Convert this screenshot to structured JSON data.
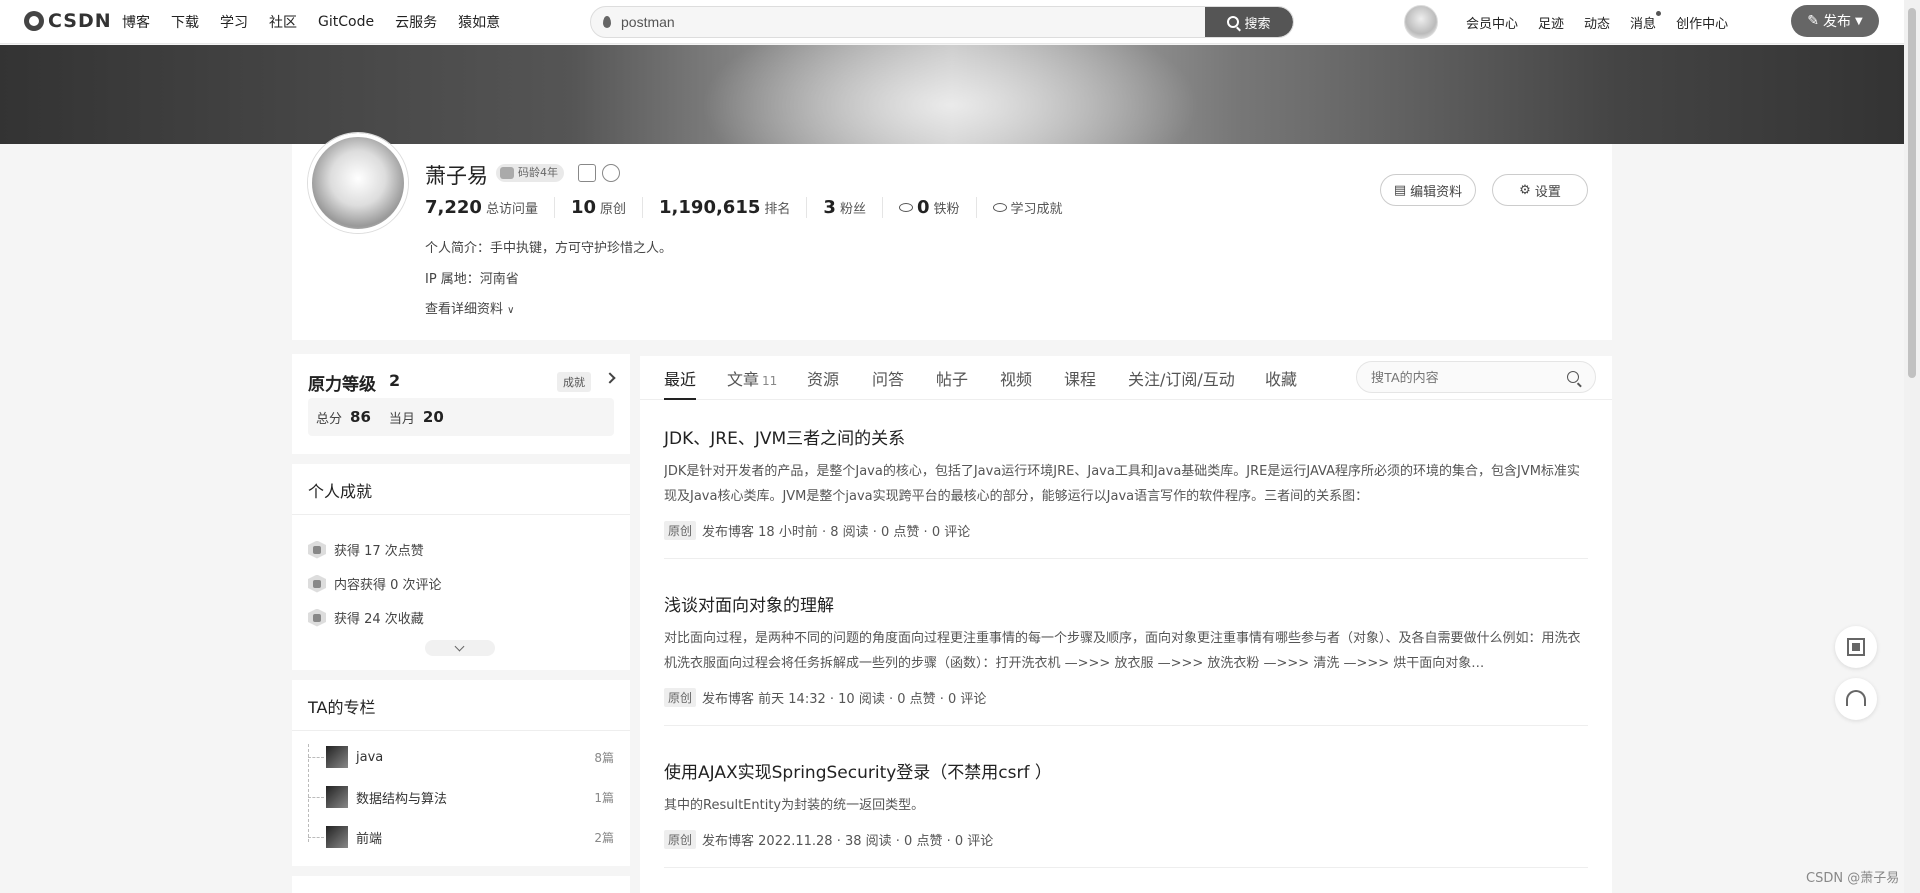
{
  "nav": {
    "logo": "CSDN",
    "links": [
      "博客",
      "下载",
      "学习",
      "社区",
      "GitCode",
      "云服务",
      "猿如意"
    ],
    "search_value": "postman",
    "search_button": "搜索",
    "right_links": [
      "会员中心",
      "足迹",
      "动态",
      "消息",
      "创作中心"
    ],
    "publish": "发布"
  },
  "profile": {
    "name": "萧子易",
    "age_badge": "码龄4年",
    "stats": [
      {
        "value": "7,220",
        "label": "总访问量"
      },
      {
        "value": "10",
        "label": "原创"
      },
      {
        "value": "1,190,615",
        "label": "排名"
      },
      {
        "value": "3",
        "label": "粉丝"
      },
      {
        "value": "0",
        "label": "铁粉"
      },
      {
        "value": "",
        "label": "学习成就"
      }
    ],
    "intro": "个人简介：手中执键，方可守护珍惜之人。",
    "ip": "IP 属地：河南省",
    "more": "查看详细资料",
    "edit_button": "编辑资料",
    "settings_button": "设置"
  },
  "level": {
    "title": "原力等级",
    "level": "2",
    "tag": "成就",
    "total_label": "总分",
    "total": "86",
    "month_label": "当月",
    "month": "20"
  },
  "achievements": {
    "title": "个人成就",
    "items": [
      "获得 17 次点赞",
      "内容获得 0 次评论",
      "获得 24 次收藏"
    ]
  },
  "columns": {
    "title": "TA的专栏",
    "items": [
      {
        "name": "java",
        "count": "8篇"
      },
      {
        "name": "数据结构与算法",
        "count": "1篇"
      },
      {
        "name": "前端",
        "count": "2篇"
      }
    ]
  },
  "tabs": {
    "items": [
      "最近",
      "文章",
      "资源",
      "问答",
      "帖子",
      "视频",
      "课程",
      "关注/订阅/互动",
      "收藏"
    ],
    "article_count": "11",
    "search_placeholder": "搜TA的内容"
  },
  "articles": [
    {
      "title": "JDK、JRE、JVM三者之间的关系",
      "summary": "JDK是针对开发者的产品，是整个Java的核心，包括了Java运行环境JRE、Java工具和Java基础类库。JRE是运行JAVA程序所必须的环境的集合，包含JVM标准实现及Java核心类库。JVM是整个java实现跨平台的最核心的部分，能够运行以Java语言写作的软件程序。三者间的关系图：",
      "tag": "原创",
      "meta": "发布博客 18 小时前 · 8 阅读 · 0 点赞 · 0 评论"
    },
    {
      "title": "浅谈对面向对象的理解",
      "summary": "对比面向过程，是两种不同的问题的角度面向过程更注重事情的每一个步骤及顺序，面向对象更注重事情有哪些参与者（对象）、及各自需要做什么例如：用洗衣机洗衣服面向过程会将任务拆解成一些列的步骤（函数）：打开洗衣机 —>>> 放衣服 —>>> 放洗衣粉 —>>> 清洗 —>>> 烘干面向对象…",
      "tag": "原创",
      "meta": "发布博客 前天 14:32 · 10 阅读 · 0 点赞 · 0 评论"
    },
    {
      "title": "使用AJAX实现SpringSecurity登录（不禁用csrf ）",
      "summary": "其中的ResultEntity为封装的统一返回类型。",
      "tag": "原创",
      "meta": "发布博客 2022.11.28 · 38 阅读 · 0 点赞 · 0 评论"
    }
  ],
  "watermark": "CSDN @萧子易"
}
